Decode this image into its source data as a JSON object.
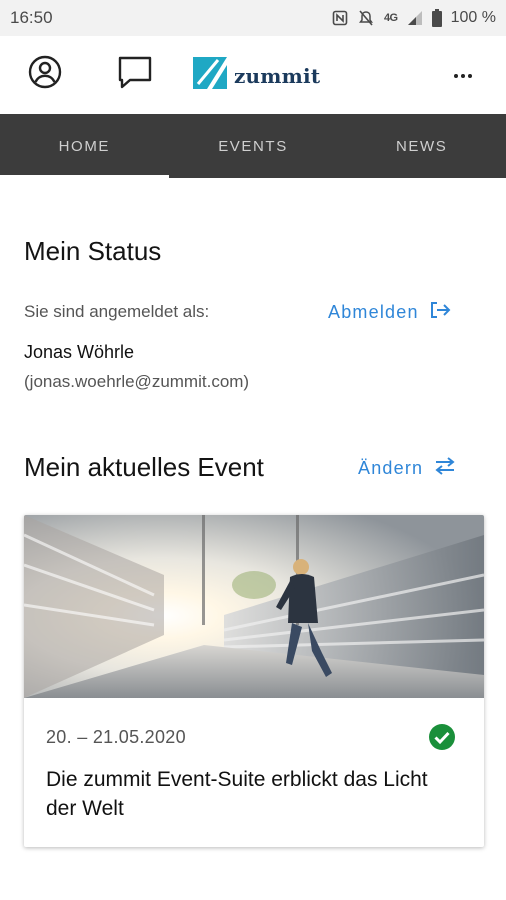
{
  "status_bar": {
    "time": "16:50",
    "network": "4G",
    "battery": "100 %",
    "icons": [
      "nfc-icon",
      "mute-icon",
      "network-4g-icon",
      "signal-icon",
      "battery-icon"
    ]
  },
  "app_bar": {
    "logo_text": "zummit",
    "icons": [
      "account-icon",
      "chat-icon",
      "more-icon"
    ]
  },
  "tabs": [
    {
      "label": "HOME",
      "active": true
    },
    {
      "label": "EVENTS",
      "active": false
    },
    {
      "label": "NEWS",
      "active": false
    }
  ],
  "status_section": {
    "title": "Mein Status",
    "logged_in_as": "Sie sind angemeldet als:",
    "logout_label": "Abmelden",
    "user_name": "Jonas Wöhrle",
    "user_email": "(jonas.woehrle@zummit.com)"
  },
  "event_section": {
    "title": "Mein aktuelles Event",
    "change_label": "Ändern",
    "card": {
      "date": "20. – 21.05.2020",
      "title": "Die zummit Event-Suite erblickt das Licht der Welt",
      "status_icon": "check-circle-icon"
    }
  },
  "colors": {
    "accent": "#2f86d8",
    "tab_bar": "#3c3c3c",
    "check": "#1a8f3a",
    "logo_teal": "#1fa8c4",
    "logo_text": "#1b3a5c"
  }
}
